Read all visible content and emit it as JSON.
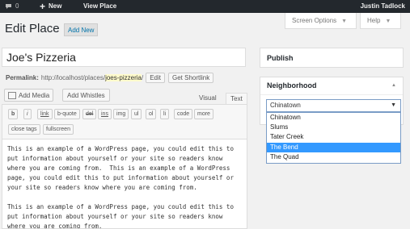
{
  "admin_bar": {
    "comment_count": "0",
    "new_label": "New",
    "view_label": "View Place",
    "user_name": "Justin Tadlock"
  },
  "screen_meta": {
    "options_label": "Screen Options",
    "help_label": "Help"
  },
  "page": {
    "title": "Edit Place",
    "add_new_label": "Add New"
  },
  "post": {
    "title": "Joe's Pizzeria",
    "permalink_label": "Permalink:",
    "permalink_base": "http://localhost/places/",
    "permalink_slug": "joes-pizzeria",
    "permalink_end": "/",
    "edit_label": "Edit",
    "shortlink_label": "Get Shortlink"
  },
  "editor": {
    "add_media_label": "Add Media",
    "add_whistles_label": "Add Whistles",
    "tab_visual": "Visual",
    "tab_text": "Text",
    "quicktags": [
      "b",
      "i",
      "link",
      "b-quote",
      "del",
      "ins",
      "img",
      "ul",
      "ol",
      "li",
      "code",
      "more"
    ],
    "quicktags_row2": [
      "close tags",
      "fullscreen"
    ],
    "paragraphs": [
      "This is an example of a WordPress page, you could edit this to\nput information about yourself or your site so readers know\nwhere you are coming from.  This is an example of a WordPress\npage, you could edit this to put information about yourself or\nyour site so readers know where you are coming from.",
      "This is an example of a WordPress page, you could edit this to\nput information about yourself or your site so readers know\nwhere you are coming from."
    ]
  },
  "sidebar": {
    "publish_title": "Publish",
    "neighborhood_title": "Neighborhood",
    "neighborhood_selected": "Chinatown",
    "neighborhood_options": [
      "Chinatown",
      "Slums",
      "Tater Creek",
      "The Bend",
      "The Quad"
    ],
    "highlighted_option": "The Bend"
  },
  "colors": {
    "admin_bar": "#23282d",
    "link": "#0073aa",
    "dropdown_highlight": "#3399ff",
    "slug_highlight": "#fffbcc"
  }
}
